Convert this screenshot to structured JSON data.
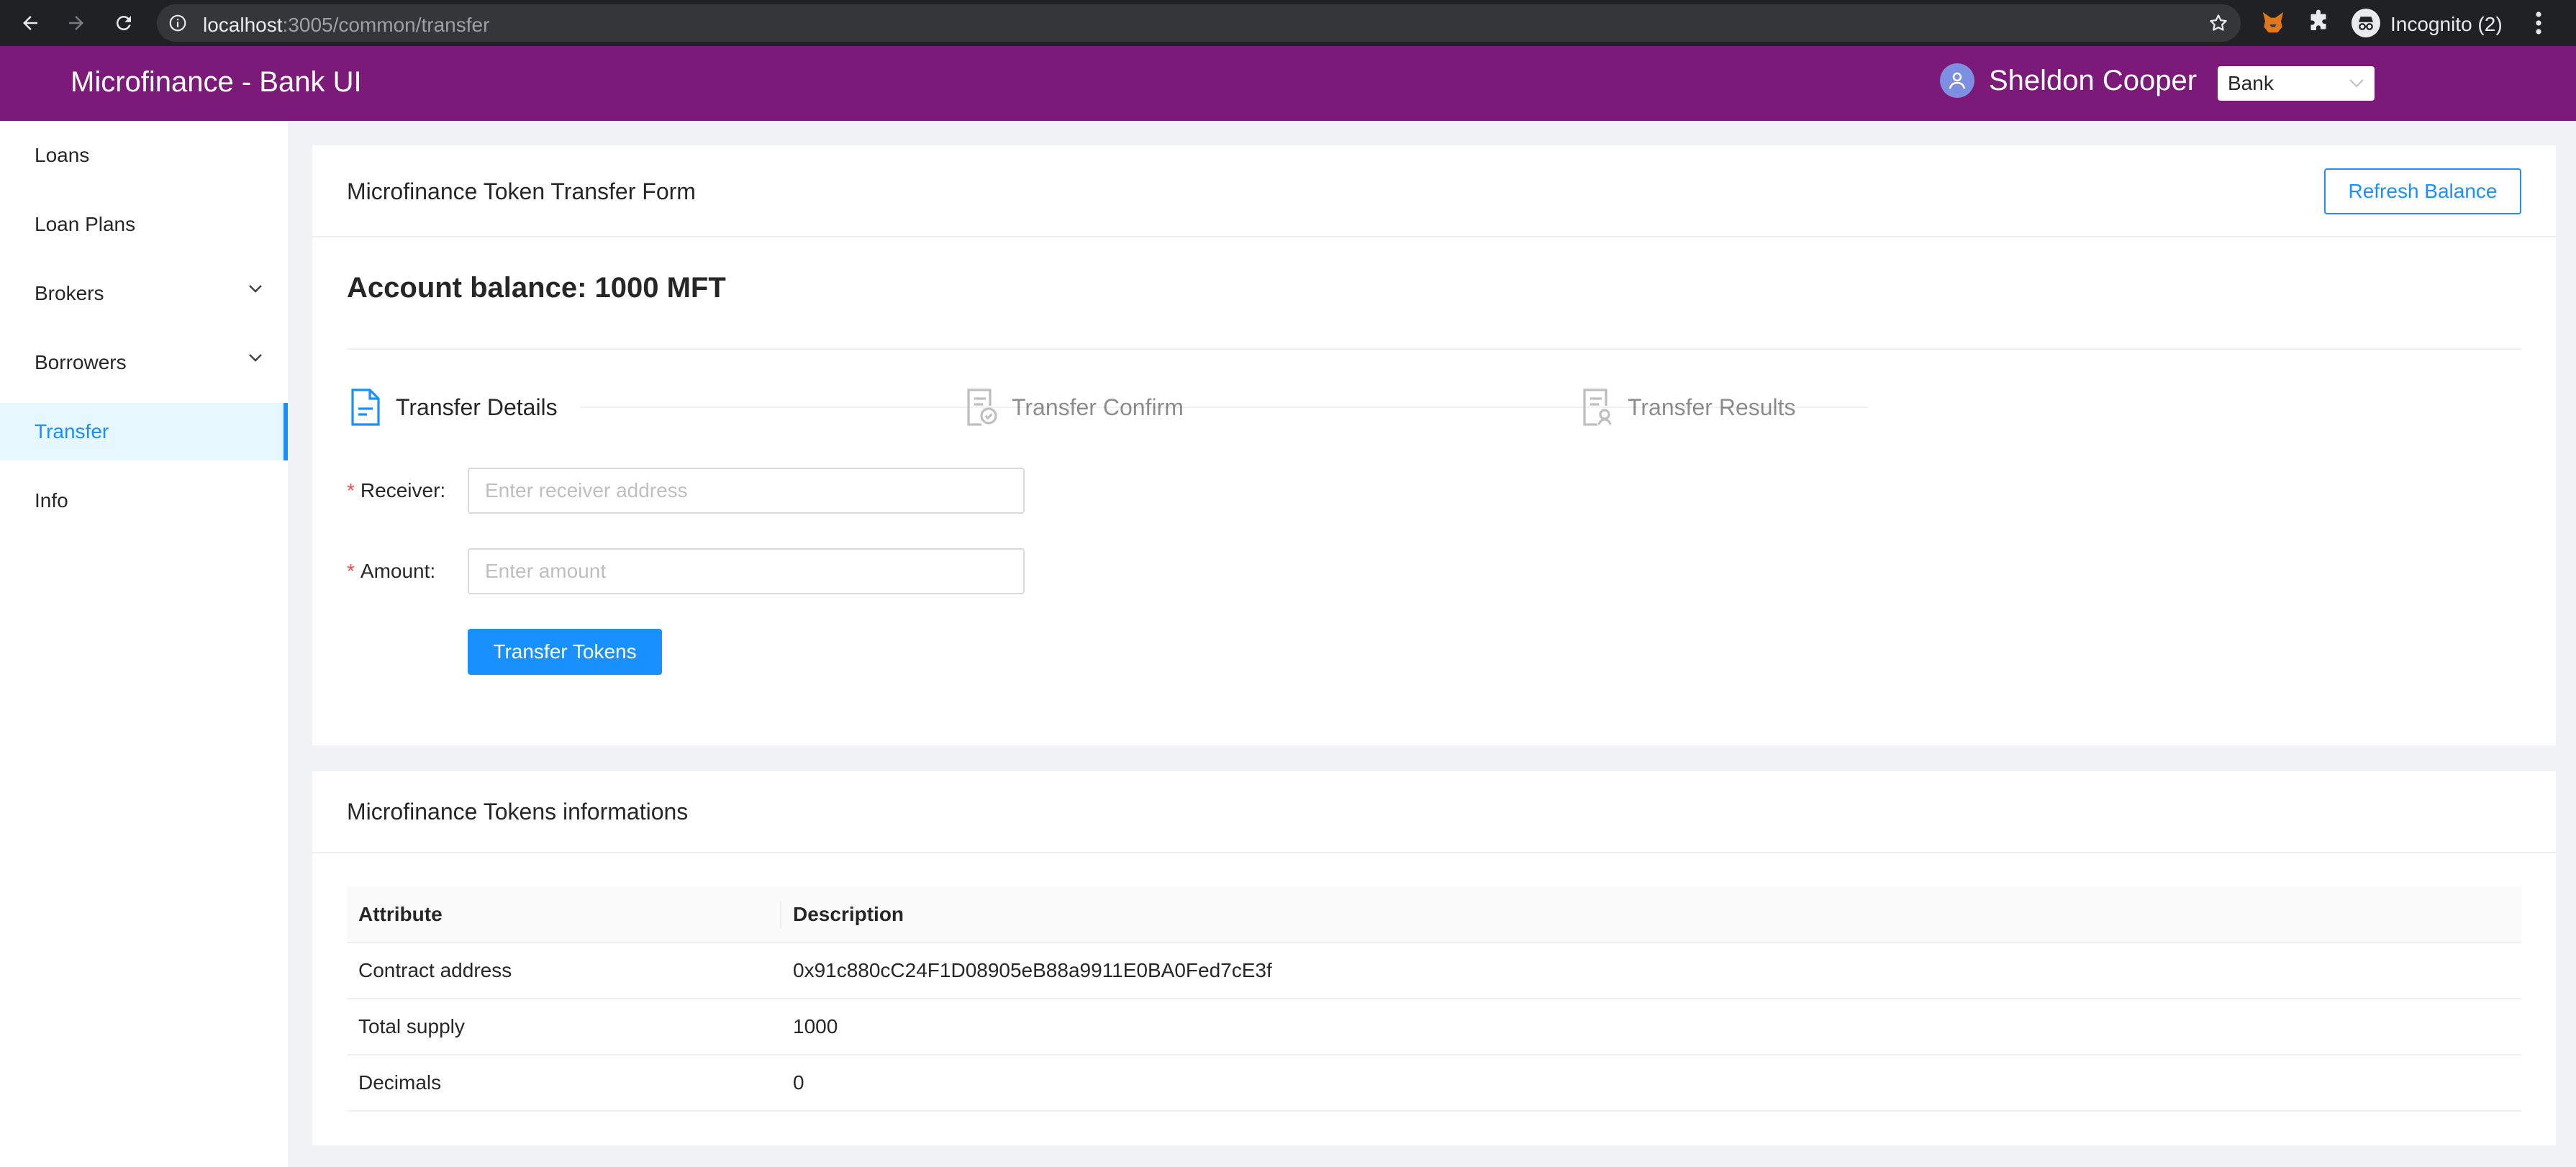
{
  "browser": {
    "url_host": "localhost",
    "url_path": ":3005/common/transfer",
    "profile_label": "Incognito (2)"
  },
  "header": {
    "app_title": "Microfinance - Bank UI",
    "user_name": "Sheldon Cooper",
    "role_selected": "Bank",
    "brand_color": "#7b1a79"
  },
  "sidebar": {
    "items": [
      {
        "label": "Loans"
      },
      {
        "label": "Loan Plans"
      },
      {
        "label": "Brokers"
      },
      {
        "label": "Borrowers"
      },
      {
        "label": "Transfer"
      },
      {
        "label": "Info"
      }
    ],
    "active_item": "Transfer"
  },
  "transfer_card": {
    "title": "Microfinance Token Transfer Form",
    "refresh_label": "Refresh Balance",
    "balance_text": "Account balance: 1000 MFT",
    "steps": [
      {
        "label": "Transfer Details",
        "state": "active"
      },
      {
        "label": "Transfer Confirm",
        "state": "wait"
      },
      {
        "label": "Transfer Results",
        "state": "wait"
      }
    ],
    "receiver_label": "Receiver",
    "receiver_placeholder": "Enter receiver address",
    "receiver_value": "",
    "amount_label": "Amount",
    "amount_placeholder": "Enter amount",
    "amount_value": "",
    "submit_label": "Transfer Tokens"
  },
  "info_card": {
    "title": "Microfinance Tokens informations",
    "columns": [
      "Attribute",
      "Description"
    ],
    "rows": [
      {
        "attribute": "Contract address",
        "description": "0x91c880cC24F1D08905eB88a9911E0BA0Fed7cE3f"
      },
      {
        "attribute": "Total supply",
        "description": "1000"
      },
      {
        "attribute": "Decimals",
        "description": "0"
      }
    ]
  },
  "colors": {
    "primary": "#1890ff",
    "required_mark": "#ff4d4f"
  }
}
